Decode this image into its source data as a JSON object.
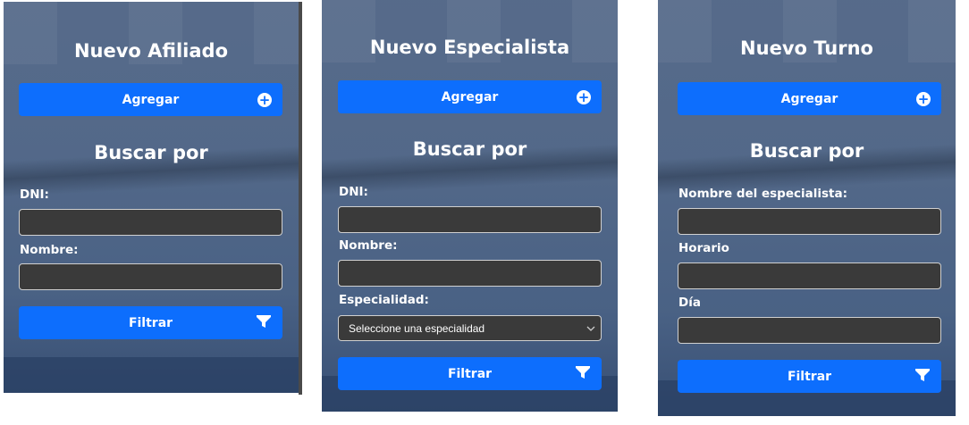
{
  "panels": [
    {
      "title": "Nuevo Afiliado",
      "add_label": "Agregar",
      "search_title": "Buscar por",
      "fields": [
        {
          "label": "DNI:",
          "value": ""
        },
        {
          "label": "Nombre:",
          "value": ""
        }
      ],
      "filter_label": "Filtrar"
    },
    {
      "title": "Nuevo Especialista",
      "add_label": "Agregar",
      "search_title": "Buscar por",
      "fields": [
        {
          "label": "DNI:",
          "value": ""
        },
        {
          "label": "Nombre:",
          "value": ""
        }
      ],
      "select": {
        "label": "Especialidad:",
        "selected": "Seleccione una especialidad"
      },
      "filter_label": "Filtrar"
    },
    {
      "title": "Nuevo Turno",
      "add_label": "Agregar",
      "search_title": "Buscar por",
      "fields": [
        {
          "label": "Nombre del especialista:",
          "value": ""
        },
        {
          "label": "Horario",
          "value": ""
        },
        {
          "label": "Día",
          "value": ""
        }
      ],
      "filter_label": "Filtrar"
    }
  ],
  "icons": {
    "add": "plus-circle-icon",
    "filter": "funnel-icon",
    "select": "chevron-down-icon"
  },
  "colors": {
    "primary": "#0d6efd",
    "input_bg": "#3a3a3a",
    "panel_bg": "#4a6286"
  }
}
